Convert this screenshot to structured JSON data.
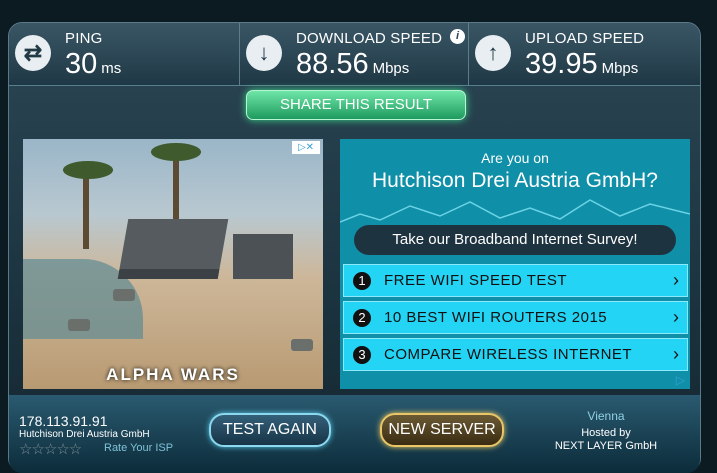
{
  "metrics": {
    "ping": {
      "label": "PING",
      "value": "30",
      "unit": "ms"
    },
    "download": {
      "label": "DOWNLOAD SPEED",
      "value": "88.56",
      "unit": "Mbps"
    },
    "upload": {
      "label": "UPLOAD SPEED",
      "value": "39.95",
      "unit": "Mbps"
    }
  },
  "share_label": "SHARE THIS RESULT",
  "ad_left": {
    "brand": "ALPHA WARS"
  },
  "ad_right": {
    "question_line1": "Are you on",
    "question_line2": "Hutchison Drei Austria GmbH?",
    "survey_label": "Take our Broadband Internet Survey!",
    "links": [
      {
        "num": "1",
        "label": "FREE WIFI SPEED TEST"
      },
      {
        "num": "2",
        "label": "10 BEST WIFI ROUTERS 2015"
      },
      {
        "num": "3",
        "label": "COMPARE WIRELESS INTERNET"
      }
    ]
  },
  "footer": {
    "ip": "178.113.91.91",
    "isp": "Hutchison Drei Austria GmbH",
    "rate_label": "Rate Your ISP",
    "test_again": "TEST AGAIN",
    "new_server": "NEW SERVER",
    "city": "Vienna",
    "hosted_by": "Hosted by",
    "host": "NEXT LAYER GmbH"
  }
}
